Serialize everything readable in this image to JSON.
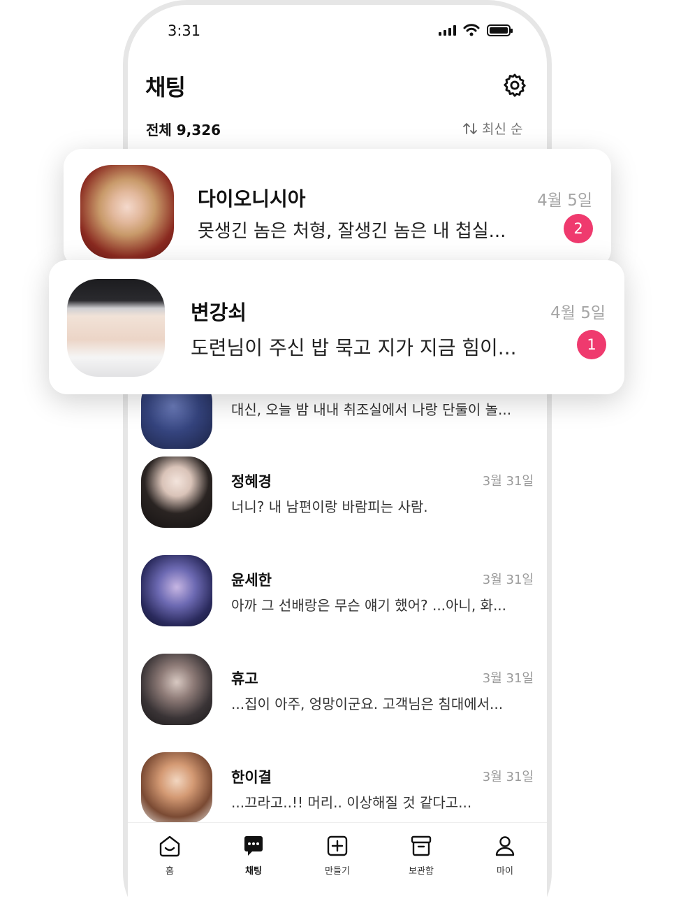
{
  "status_bar": {
    "time": "3:31"
  },
  "header": {
    "title": "채팅",
    "settings_icon": "gear-icon"
  },
  "summary": {
    "total_label": "전체 9,326",
    "sort_label": "최신 순",
    "sort_icon": "sort-arrows-icon"
  },
  "featured_chats": [
    {
      "name": "다이오니시아",
      "date": "4월 5일",
      "message": "못생긴 놈은 처형, 잘생긴 놈은 내 첩실...",
      "unread": "2"
    },
    {
      "name": "변강쇠",
      "date": "4월 5일",
      "message": "도련님이 주신 밥 묵고 지가 지금 힘이...",
      "unread": "1"
    }
  ],
  "chats": [
    {
      "message": "대신, 오늘 밤 내내 취조실에서 나랑 단둘이 놀..."
    },
    {
      "name": "정혜경",
      "date": "3월 31일",
      "message": "너니? 내 남편이랑 바람피는 사람."
    },
    {
      "name": "윤세한",
      "date": "3월 31일",
      "message": "아까 그 선배랑은 무슨 얘기 했어? ...아니, 화..."
    },
    {
      "name": "휴고",
      "date": "3월 31일",
      "message": "...집이 아주, 엉망이군요. 고객님은 침대에서..."
    },
    {
      "name": "한이결",
      "date": "3월 31일",
      "message": "...끄라고..!! 머리.. 이상해질 것 같다고..."
    }
  ],
  "bottom_nav": [
    {
      "label": "홈",
      "icon": "home-smile-icon"
    },
    {
      "label": "채팅",
      "icon": "chat-bubble-icon",
      "active": true
    },
    {
      "label": "만들기",
      "icon": "plus-square-icon"
    },
    {
      "label": "보관함",
      "icon": "archive-box-icon"
    },
    {
      "label": "마이",
      "icon": "user-icon"
    }
  ],
  "colors": {
    "badge": "#ef3a6e",
    "frame": "#e6e6e6"
  }
}
